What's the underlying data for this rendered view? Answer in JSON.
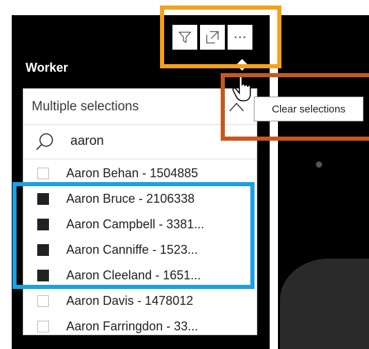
{
  "toolbar": {
    "buttons": [
      {
        "icon": "filter-icon"
      },
      {
        "icon": "focus-mode-icon"
      },
      {
        "icon": "more-options-icon",
        "label": "···"
      }
    ]
  },
  "slicer": {
    "title": "Worker",
    "dropdown_label": "Multiple selections",
    "search_value": "aaron",
    "items": [
      {
        "label": "Aaron Behan - 1504885",
        "checked": false
      },
      {
        "label": "Aaron Bruce - 2106338",
        "checked": true
      },
      {
        "label": "Aaron Campbell - 3381...",
        "checked": true
      },
      {
        "label": "Aaron Canniffe - 1523...",
        "checked": true
      },
      {
        "label": "Aaron Cleeland - 1651...",
        "checked": true
      },
      {
        "label": "Aaron Davis - 1478012",
        "checked": false
      },
      {
        "label": "Aaron Farringdon - 33...",
        "checked": false
      }
    ]
  },
  "tooltip": {
    "text": "Clear selections"
  },
  "colors": {
    "highlight_orange": "#f6a11b",
    "highlight_red": "#c5581f",
    "highlight_blue": "#1ba1e2"
  }
}
